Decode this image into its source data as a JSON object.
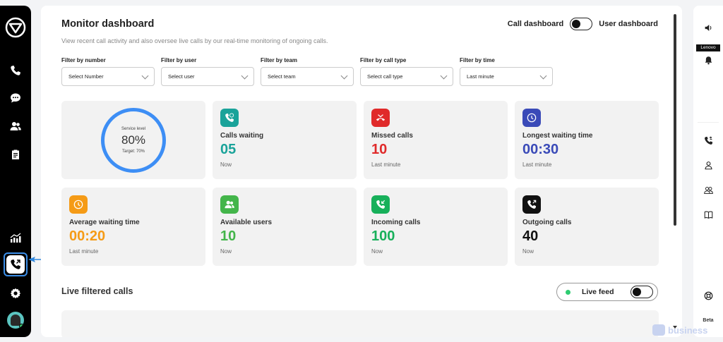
{
  "header": {
    "title": "Monitor dashboard",
    "subtitle": "View recent call activity and also oversee live calls by our real-time monitoring of ongoing calls.",
    "toggle_left": "Call dashboard",
    "toggle_right": "User dashboard"
  },
  "filters": [
    {
      "label": "Filter by number",
      "value": "Select Number"
    },
    {
      "label": "Filter by user",
      "value": "Select user"
    },
    {
      "label": "Filter by team",
      "value": "Select team"
    },
    {
      "label": "Filter by call type",
      "value": "Select call type"
    },
    {
      "label": "Filter by time",
      "value": "Last minute"
    }
  ],
  "service_level": {
    "label": "Service level",
    "value": "80%",
    "target": "Target: 70%"
  },
  "cards": [
    {
      "title": "Calls waiting",
      "value": "05",
      "sub": "Now",
      "color": "#1aa39a",
      "icon": "phone-clock-icon"
    },
    {
      "title": "Missed calls",
      "value": "10",
      "sub": "Last minute",
      "color": "#e02a2a",
      "icon": "missed-call-icon"
    },
    {
      "title": "Longest waiting time",
      "value": "00:30",
      "sub": "Last minute",
      "color": "#3a4ab8",
      "icon": "clock-icon"
    },
    {
      "title": "Average waiting time",
      "value": "00:20",
      "sub": "Last minute",
      "color": "#f59b16",
      "icon": "clock-icon"
    },
    {
      "title": "Available users",
      "value": "10",
      "sub": "Now",
      "color": "#43b54a",
      "icon": "users-icon"
    },
    {
      "title": "Incoming calls",
      "value": "100",
      "sub": "Now",
      "color": "#17b05a",
      "icon": "incoming-call-icon"
    },
    {
      "title": "Outgoing calls",
      "value": "40",
      "sub": "Now",
      "color": "#111111",
      "icon": "outgoing-call-icon"
    }
  ],
  "live": {
    "title": "Live filtered calls",
    "feed_label": "Live feed"
  },
  "right_sidebar": {
    "brand": "Lenovo",
    "beta": "Beta"
  },
  "watermark": {
    "text": "business"
  }
}
